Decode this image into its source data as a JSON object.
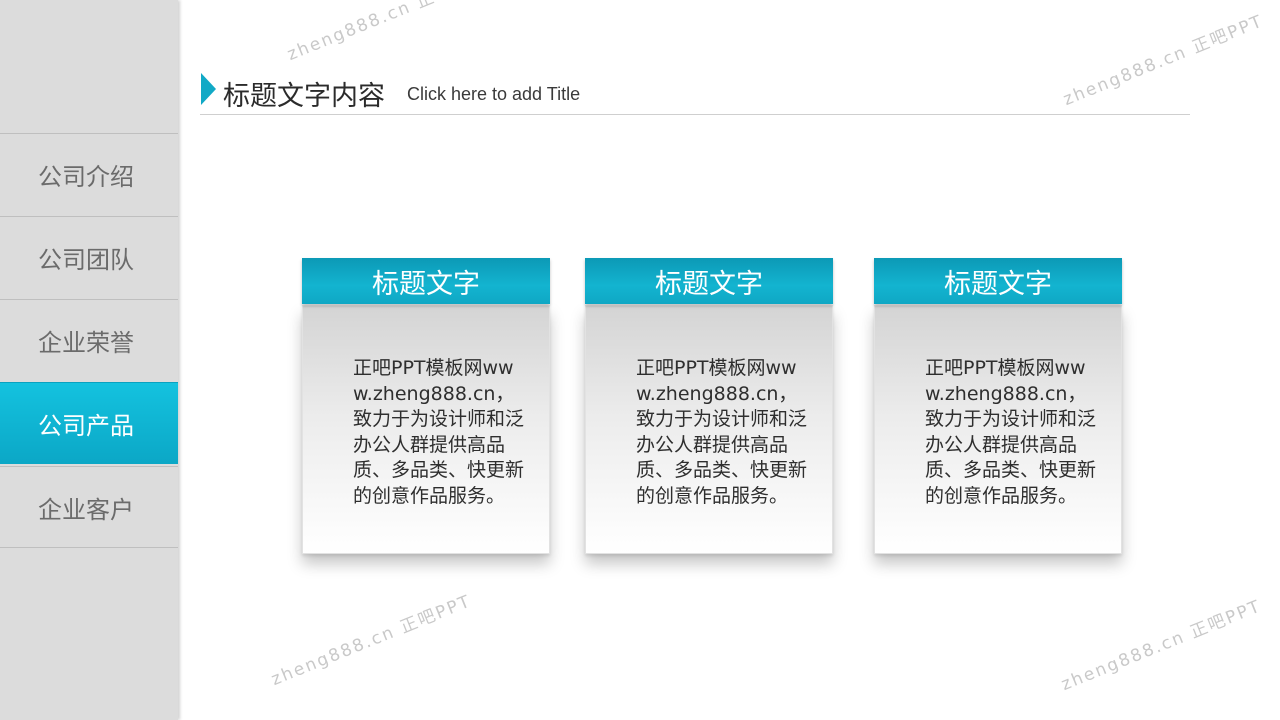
{
  "sidebar": {
    "items": [
      {
        "label": "公司介绍",
        "active": false
      },
      {
        "label": "公司团队",
        "active": false
      },
      {
        "label": "企业荣誉",
        "active": false
      },
      {
        "label": "公司产品",
        "active": true
      },
      {
        "label": "企业客户",
        "active": false
      }
    ]
  },
  "header": {
    "title": "标题文字内容",
    "subtitle": "Click here to add Title"
  },
  "cards": [
    {
      "title": "标题文字",
      "body": "正吧PPT模板网www.zheng888.cn，致力于为设计师和泛办公人群提供高品质、多品类、快更新的创意作品服务。"
    },
    {
      "title": "标题文字",
      "body": "正吧PPT模板网www.zheng888.cn，致力于为设计师和泛办公人群提供高品质、多品类、快更新的创意作品服务。"
    },
    {
      "title": "标题文字",
      "body": "正吧PPT模板网www.zheng888.cn，致力于为设计师和泛办公人群提供高品质、多品类、快更新的创意作品服务。"
    }
  ],
  "watermark": {
    "text": "zheng888.cn 正吧PPT"
  },
  "colors": {
    "accent": "#11a9c6",
    "sidebar_bg": "#dcdcdc",
    "card_header": "#13b4d0"
  }
}
